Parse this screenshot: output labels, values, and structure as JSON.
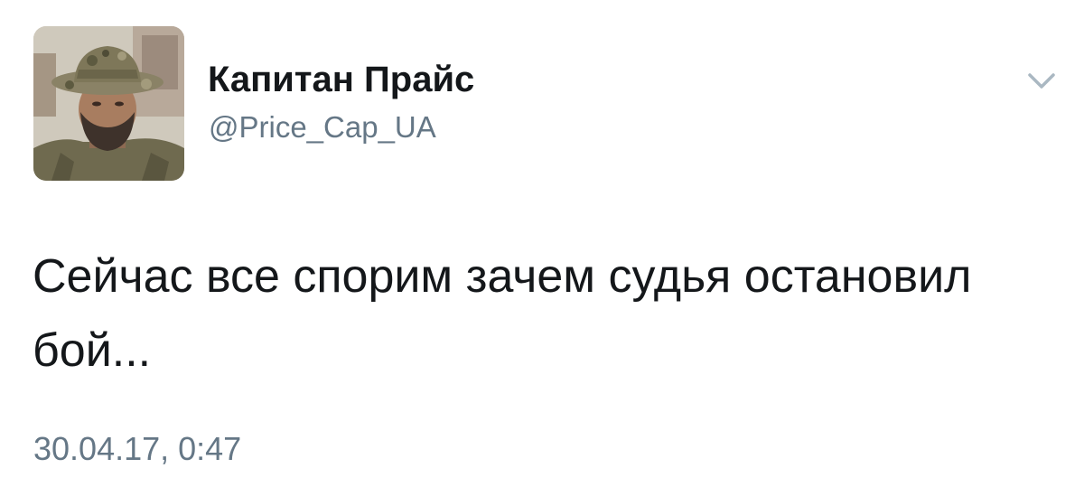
{
  "tweet": {
    "display_name": "Капитан Прайс",
    "handle": "@Price_Cap_UA",
    "text": "Сейчас все спорим зачем судья остановил бой...",
    "timestamp": "30.04.17, 0:47"
  },
  "icons": {
    "menu": "chevron-down-icon",
    "avatar": "profile-photo"
  },
  "colors": {
    "name_text": "#14171a",
    "secondary_text": "#657786",
    "caret": "#aab8c2"
  }
}
